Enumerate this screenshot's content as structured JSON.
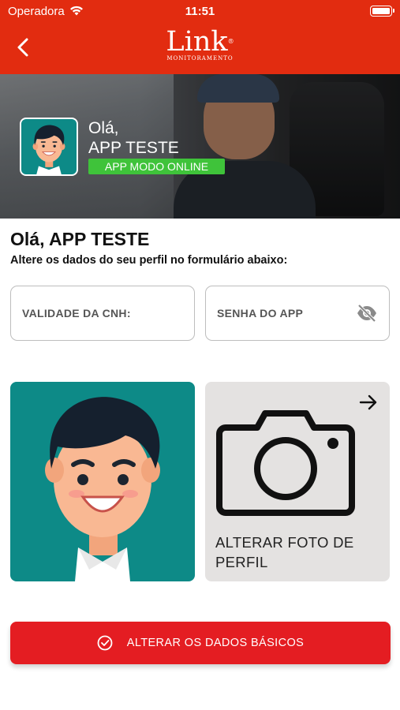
{
  "status_bar": {
    "carrier": "Operadora",
    "time": "11:51"
  },
  "nav": {
    "logo_word": "Link",
    "logo_sub": "MONITORAMENTO"
  },
  "banner": {
    "greeting_line1": "Olá,",
    "greeting_line2": "APP TESTE",
    "status": "APP MODO ONLINE"
  },
  "main": {
    "title": "Olá, APP TESTE",
    "subtitle": "Altere os dados do seu perfil no formulário abaixo:"
  },
  "form": {
    "cnh_placeholder": "VALIDADE DA CNH:",
    "cnh_value": "",
    "password_placeholder": "SENHA DO APP",
    "password_value": ""
  },
  "photo": {
    "change_label": "ALTERAR FOTO DE PERFIL"
  },
  "actions": {
    "submit_label": "ALTERAR OS DADOS BÁSICOS"
  },
  "colors": {
    "brand_red": "#e22c10",
    "button_red": "#e41d22",
    "online_green": "#3fc33a",
    "avatar_teal": "#0d8a87",
    "card_gray": "#e4e2e1"
  }
}
